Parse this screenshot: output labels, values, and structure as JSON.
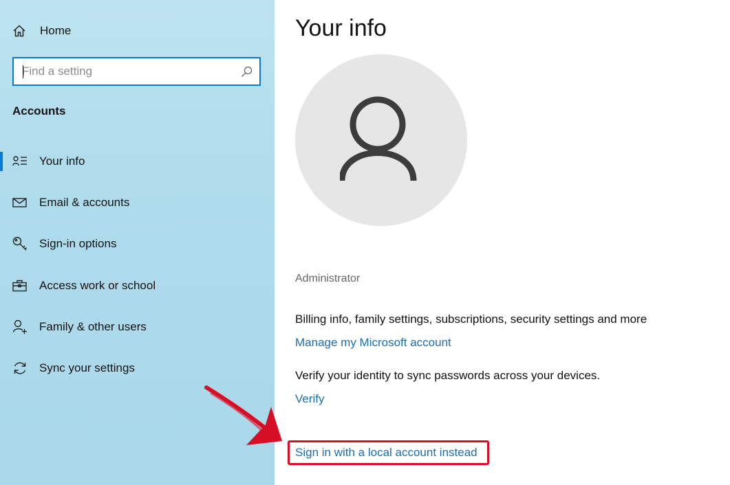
{
  "sidebar": {
    "home": {
      "label": "Home",
      "icon": "home-icon"
    },
    "search": {
      "placeholder": "Find a setting",
      "value": "",
      "icon": "search-icon"
    },
    "section_title": "Accounts",
    "items": [
      {
        "label": "Your info",
        "icon": "person-list-icon",
        "active": true
      },
      {
        "label": "Email & accounts",
        "icon": "mail-icon",
        "active": false
      },
      {
        "label": "Sign-in options",
        "icon": "key-icon",
        "active": false
      },
      {
        "label": "Access work or school",
        "icon": "briefcase-icon",
        "active": false
      },
      {
        "label": "Family & other users",
        "icon": "person-add-icon",
        "active": false
      },
      {
        "label": "Sync your settings",
        "icon": "sync-icon",
        "active": false
      }
    ]
  },
  "main": {
    "title": "Your info",
    "avatar_icon": "user-avatar-icon",
    "username": "Administrator",
    "billing_text": "Billing info, family settings, subscriptions, security settings and more",
    "manage_link": "Manage my Microsoft account",
    "verify_text": "Verify your identity to sync passwords across your devices.",
    "verify_link": "Verify",
    "local_account_link": "Sign in with a local account instead"
  },
  "colors": {
    "sidebar_bg": "#b0dcec",
    "accent": "#0a78d7",
    "link": "#1a6fae",
    "highlight": "#d40f26"
  }
}
